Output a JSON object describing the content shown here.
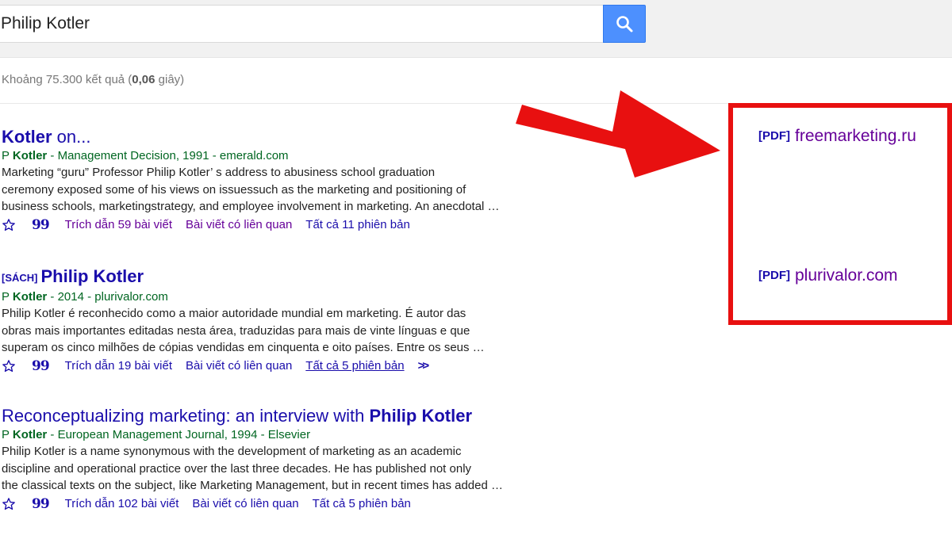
{
  "search": {
    "value": "Philip Kotler"
  },
  "stats": {
    "prefix": "Khoảng 75.300 kết quả (",
    "time": "0,06",
    "suffix": " giây)"
  },
  "results": [
    {
      "title_bold": "Kotler",
      "title_rest": " on...",
      "meta_author": "P ",
      "meta_bold": "Kotler",
      "meta_rest": " - Management Decision, 1991 - emerald.com",
      "snippet": [
        "Marketing “guru” Professor Philip Kotler’ s address to abusiness school graduation",
        "ceremony exposed some of his views on issuessuch as the marketing and positioning of",
        "business schools, marketingstrategy, and employee involvement in marketing. An anecdotal …"
      ],
      "cite": "Trích dẫn 59 bài viết",
      "related": "Bài viết có liên quan",
      "versions": "Tất cả 11 phiên bản"
    },
    {
      "tag": "[SÁCH]",
      "title_bold": "Philip Kotler",
      "meta_author": "P ",
      "meta_bold": "Kotler",
      "meta_rest": " - 2014 - plurivalor.com",
      "snippet": [
        "Philip Kotler é reconhecido como a maior autoridade mundial em marketing. É autor das",
        "obras mais importantes editadas nesta área, traduzidas para mais de vinte línguas e que",
        "superam os cinco milhões de cópias vendidas em cinquenta e oito países. Entre os seus …"
      ],
      "cite": "Trích dẫn 19 bài viết",
      "related": "Bài viết có liên quan",
      "versions": "Tất cả 5 phiên bản"
    },
    {
      "title_rest": "Reconceptualizing marketing: an interview with ",
      "title_bold": "Philip Kotler",
      "meta_author": "P ",
      "meta_bold": "Kotler",
      "meta_rest": " - European Management Journal, 1994 - Elsevier",
      "snippet": [
        "Philip Kotler is a name synonymous with the development of marketing as an academic",
        "discipline and operational practice over the last three decades. He has published not only",
        "the classical texts on the subject, like Marketing Management, but in recent times has added …"
      ],
      "cite": "Trích dẫn 102 bài viết",
      "related": "Bài viết có liên quan",
      "versions": "Tất cả 5 phiên bản"
    }
  ],
  "side_links": [
    {
      "tag": "[PDF]",
      "domain": "freemarketing.ru"
    },
    {
      "tag": "[PDF]",
      "domain": "plurivalor.com"
    }
  ],
  "icons": {
    "search": "search-icon",
    "save": "star-icon",
    "cite": "quote-icon",
    "more": "double-chevron-icon",
    "annotation": "arrow-icon"
  },
  "colors": {
    "link": "#1a0dab",
    "visited": "#660099",
    "meta": "#006621",
    "search_button": "#4d90fe",
    "highlight": "#e81010"
  }
}
